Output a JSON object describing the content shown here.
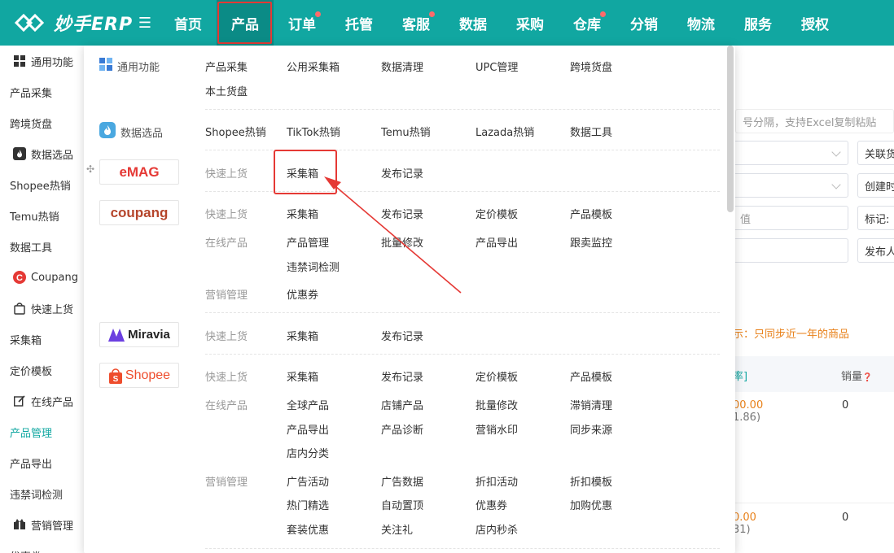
{
  "brand": {
    "name": "妙手ERP"
  },
  "nav": [
    {
      "label": "首页",
      "dot": false,
      "active": false
    },
    {
      "label": "产品",
      "dot": false,
      "active": true
    },
    {
      "label": "订单",
      "dot": true,
      "active": false
    },
    {
      "label": "托管",
      "dot": false,
      "active": false
    },
    {
      "label": "客服",
      "dot": true,
      "active": false
    },
    {
      "label": "数据",
      "dot": false,
      "active": false
    },
    {
      "label": "采购",
      "dot": false,
      "active": false
    },
    {
      "label": "仓库",
      "dot": true,
      "active": false
    },
    {
      "label": "分销",
      "dot": false,
      "active": false
    },
    {
      "label": "物流",
      "dot": false,
      "active": false
    },
    {
      "label": "服务",
      "dot": false,
      "active": false
    },
    {
      "label": "授权",
      "dot": false,
      "active": false
    }
  ],
  "sidebar": [
    {
      "label": "通用功能",
      "group": true,
      "icon": "grid-icon"
    },
    {
      "label": "产品采集",
      "group": false
    },
    {
      "label": "跨境货盘",
      "group": false
    },
    {
      "label": "数据选品",
      "group": true,
      "icon": "flame-icon"
    },
    {
      "label": "Shopee热销",
      "group": false
    },
    {
      "label": "Temu热销",
      "group": false
    },
    {
      "label": "数据工具",
      "group": false
    },
    {
      "label": "Coupang",
      "group": true,
      "icon": "coupang-icon"
    },
    {
      "label": "快速上货",
      "group": true,
      "icon": "bag-icon"
    },
    {
      "label": "采集箱",
      "group": false
    },
    {
      "label": "定价模板",
      "group": false
    },
    {
      "label": "在线产品",
      "group": true,
      "icon": "edit-icon"
    },
    {
      "label": "产品管理",
      "group": false,
      "active": true
    },
    {
      "label": "产品导出",
      "group": false
    },
    {
      "label": "违禁词检测",
      "group": false
    },
    {
      "label": "营销管理",
      "group": true,
      "icon": "gift-icon"
    },
    {
      "label": "优惠券",
      "group": false
    }
  ],
  "background": {
    "search_placeholder": "号分隔，支持Excel复制粘贴",
    "btn1": "关联货",
    "btn2": "创建时",
    "value_hint": "值",
    "tag_label": "标记:",
    "publish_label": "发布人",
    "notice": "示：只同步近一年的商品",
    "col_rate": "率]",
    "col_sales": "销量",
    "row1_price": "00.00",
    "row1_sub": "1.86)",
    "row1_sales": "0",
    "row2_price": "0.00",
    "row2_sub": "31)",
    "row2_sales": "0"
  },
  "panel": {
    "general": {
      "title": "通用功能",
      "items": [
        "产品采集",
        "公用采集箱",
        "数据清理",
        "UPC管理",
        "跨境货盘",
        "本土货盘"
      ]
    },
    "data": {
      "title": "数据选品",
      "items": [
        "Shopee热销",
        "TikTok热销",
        "Temu热销",
        "Lazada热销",
        "数据工具"
      ]
    },
    "emag": {
      "logo": "eMAG",
      "cat": "快速上货",
      "items": [
        "采集箱",
        "发布记录"
      ]
    },
    "coupang": {
      "logo": "coupang",
      "cat1": "快速上货",
      "items1": [
        "采集箱",
        "发布记录",
        "定价模板",
        "产品模板"
      ],
      "cat2": "在线产品",
      "items2": [
        "产品管理",
        "批量修改",
        "产品导出",
        "跟卖监控",
        "违禁词检测"
      ],
      "cat3": "营销管理",
      "items3": [
        "优惠券"
      ]
    },
    "miravia": {
      "logo": "Miravia",
      "cat": "快速上货",
      "items": [
        "采集箱",
        "发布记录"
      ]
    },
    "shopee": {
      "logo": "Shopee",
      "cat1": "快速上货",
      "items1": [
        "采集箱",
        "发布记录",
        "定价模板",
        "产品模板"
      ],
      "cat2": "在线产品",
      "items2": [
        "全球产品",
        "店铺产品",
        "批量修改",
        "滞销清理",
        "产品导出",
        "产品诊断",
        "营销水印",
        "同步来源",
        "店内分类"
      ],
      "cat3": "营销管理",
      "items3": [
        "广告活动",
        "广告数据",
        "折扣活动",
        "折扣模板",
        "热门精选",
        "自动置顶",
        "优惠券",
        "加购优惠",
        "套装优惠",
        "关注礼",
        "店内秒杀"
      ]
    }
  },
  "colors": {
    "brand": "#11a7a1",
    "highlight": "#e53935"
  }
}
